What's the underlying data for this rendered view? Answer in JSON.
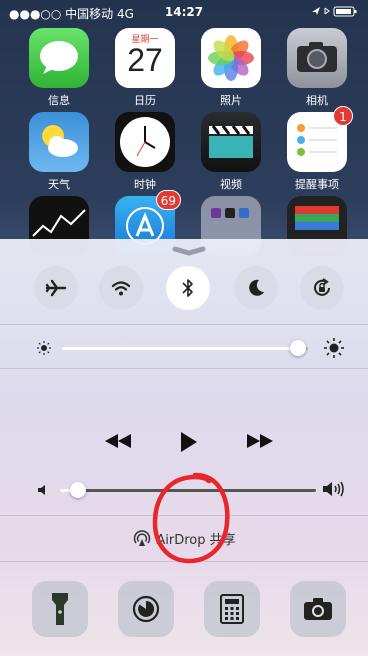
{
  "status_bar": {
    "carrier": "●●●○○ 中国移动 4G",
    "time": "14:27",
    "right_icons": "location-bluetooth-battery"
  },
  "home_apps": [
    {
      "name": "信息",
      "icon": "messages-icon"
    },
    {
      "name": "日历",
      "icon": "calendar-icon",
      "weekday": "星期一",
      "day": "27"
    },
    {
      "name": "照片",
      "icon": "photos-icon"
    },
    {
      "name": "相机",
      "icon": "camera-icon"
    },
    {
      "name": "天气",
      "icon": "weather-icon"
    },
    {
      "name": "时钟",
      "icon": "clock-icon"
    },
    {
      "name": "视频",
      "icon": "videos-icon"
    },
    {
      "name": "提醒事项",
      "icon": "reminders-icon",
      "badge": "1"
    },
    {
      "name": "",
      "icon": "stocks-icon"
    },
    {
      "name": "",
      "icon": "app-store-icon",
      "badge": "69"
    },
    {
      "name": "",
      "icon": "folder-icon"
    },
    {
      "name": "",
      "icon": "wallet-icon"
    }
  ],
  "control_center": {
    "toggles": [
      {
        "name": "airplane-mode",
        "icon": "airplane-icon",
        "on": false
      },
      {
        "name": "wifi",
        "icon": "wifi-icon",
        "on": false
      },
      {
        "name": "bluetooth",
        "icon": "bluetooth-icon",
        "on": true,
        "highlighted": true
      },
      {
        "name": "do-not-disturb",
        "icon": "moon-icon",
        "on": false
      },
      {
        "name": "rotation-lock",
        "icon": "rotation-lock-icon",
        "on": false
      }
    ],
    "brightness": 0.96,
    "volume": 0.07,
    "media_controls": [
      "rewind-icon",
      "play-icon",
      "fast-forward-icon"
    ],
    "airdrop_label": "AirDrop 共享",
    "shortcuts": [
      "flashlight-icon",
      "timer-icon",
      "calculator-icon",
      "camera-icon"
    ],
    "annotation_color": "#e8262b"
  }
}
